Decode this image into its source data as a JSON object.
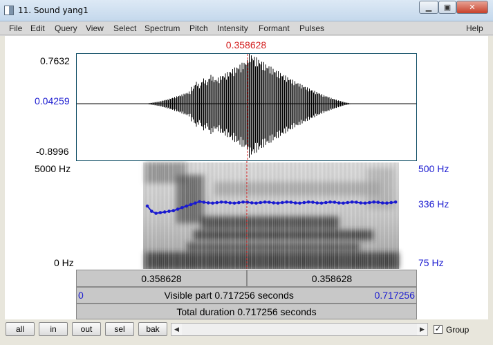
{
  "window": {
    "title": "11. Sound yang1"
  },
  "menu": [
    "File",
    "Edit",
    "Query",
    "View",
    "Select",
    "Spectrum",
    "Pitch",
    "Intensity",
    "Formant",
    "Pulses",
    "Help"
  ],
  "cursor": {
    "time": "0.358628"
  },
  "waveform": {
    "max_label": "0.7632",
    "cursor_value": "0.04259",
    "min_label": "-0.8996"
  },
  "spectrogram": {
    "top_label": "5000 Hz",
    "bottom_label": "0 Hz"
  },
  "pitch": {
    "top_label": "500 Hz",
    "current_label": "336 Hz",
    "bottom_label": "75 Hz"
  },
  "timebars": {
    "left_segment": "0.358628",
    "right_segment": "0.358628",
    "visible_start": "0",
    "visible_text": "Visible part 0.717256 seconds",
    "visible_end": "0.717256",
    "total_text": "Total duration 0.717256 seconds"
  },
  "toolbar": {
    "all": "all",
    "in": "in",
    "out": "out",
    "sel": "sel",
    "bak": "bak",
    "group_label": "Group",
    "group_checked": "✓"
  },
  "icons": {
    "scroll_left": "◀",
    "scroll_right": "▶",
    "minimize": "▁",
    "maximize": "▣",
    "close": "✕"
  },
  "colors": {
    "cursor": "#d42020",
    "pitch": "#1a1ad0",
    "frame": "#0b4a62"
  }
}
